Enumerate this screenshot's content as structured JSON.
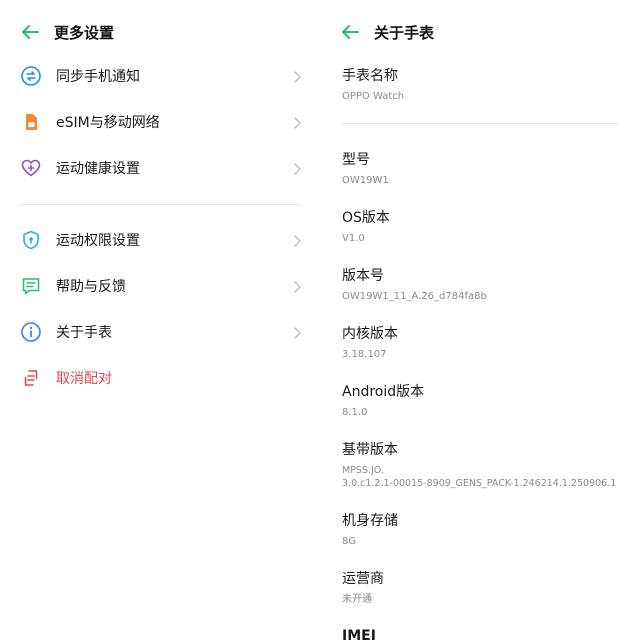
{
  "left_panel": {
    "title": "更多设置",
    "groups": [
      [
        {
          "label": "同步手机通知",
          "icon": "sync-notification-icon",
          "color": "#1f8fd8"
        },
        {
          "label": "eSIM与移动网络",
          "icon": "sim-card-icon",
          "color": "#f08a3c"
        },
        {
          "label": "运动健康设置",
          "icon": "heart-plus-icon",
          "color": "#8c4fd1"
        }
      ],
      [
        {
          "label": "运动权限设置",
          "icon": "shield-icon",
          "color": "#2ab2c9"
        },
        {
          "label": "帮助与反馈",
          "icon": "feedback-icon",
          "color": "#2bbf6a"
        },
        {
          "label": "关于手表",
          "icon": "info-icon",
          "color": "#3d7fe0"
        }
      ]
    ],
    "unpair": {
      "label": "取消配对",
      "icon": "unpair-icon",
      "color": "#e5484d"
    }
  },
  "right_panel": {
    "title": "关于手表",
    "watch_name": {
      "label": "手表名称",
      "value": "OPPO Watch"
    },
    "items": [
      {
        "label": "型号",
        "value": "OW19W1"
      },
      {
        "label": "OS版本",
        "value": "V1.0"
      },
      {
        "label": "版本号",
        "value": "OW19W1_11_A.26_d784fa8b"
      },
      {
        "label": "内核版本",
        "value": "3.18.107"
      },
      {
        "label": "Android版本",
        "value": "8.1.0"
      },
      {
        "label": "基带版本",
        "value": "MPSS.JO.\n3.0.c1.2.1-00015-8909_GENS_PACK-1.246214.1.250906.1"
      },
      {
        "label": "机身存储",
        "value": "8G"
      },
      {
        "label": "运营商",
        "value": "未开通"
      },
      {
        "label": "IMEI",
        "value": ""
      }
    ]
  },
  "accent_color": "#2bbf6a"
}
